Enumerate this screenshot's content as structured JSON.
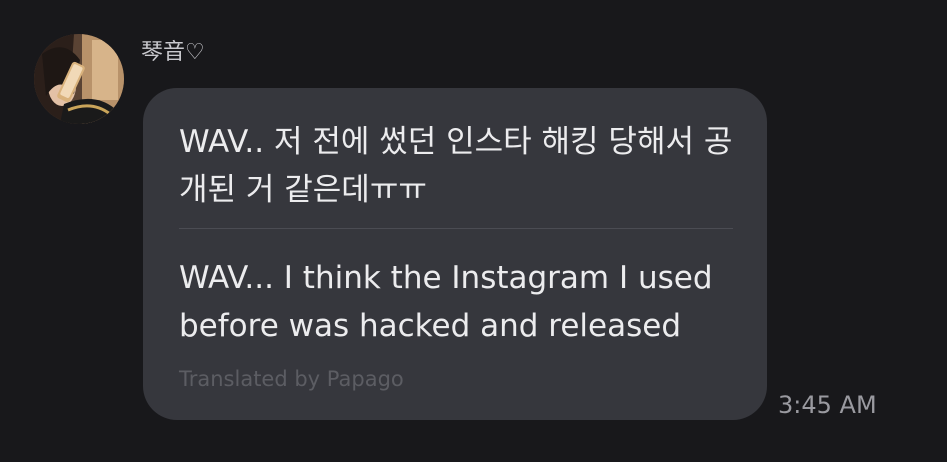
{
  "message": {
    "sender_name": "琴音♡",
    "original_text": "WAV.. 저 전에 썼던 인스타 해킹 당해서 공개된 거 같은데ㅠㅠ",
    "translated_text": "WAV... I think the Instagram I used before was hacked and released",
    "translator_credit": "Translated by Papago",
    "timestamp": "3:45 AM"
  },
  "colors": {
    "background": "#18181b",
    "bubble": "#36373d",
    "text_primary": "#ececee",
    "text_muted": "#5c5d63",
    "timestamp": "#9a9aa0"
  }
}
